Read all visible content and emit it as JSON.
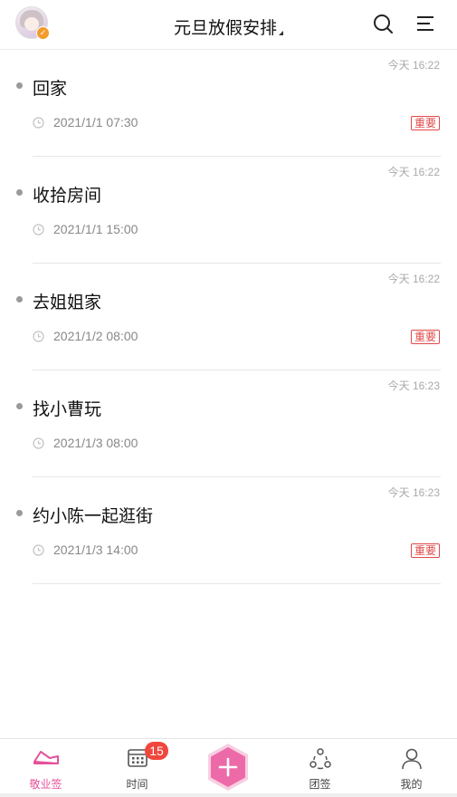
{
  "header": {
    "title": "元旦放假安排"
  },
  "items": [
    {
      "updated": "今天 16:22",
      "text": "回家",
      "time": "2021/1/1 07:30",
      "tag": "重要"
    },
    {
      "updated": "今天 16:22",
      "text": "收拾房间",
      "time": "2021/1/1 15:00",
      "tag": ""
    },
    {
      "updated": "今天 16:22",
      "text": "去姐姐家",
      "time": "2021/1/2 08:00",
      "tag": "重要"
    },
    {
      "updated": "今天 16:23",
      "text": "找小曹玩",
      "time": "2021/1/3 08:00",
      "tag": ""
    },
    {
      "updated": "今天 16:23",
      "text": "约小陈一起逛街",
      "time": "2021/1/3 14:00",
      "tag": "重要"
    }
  ],
  "tabs": {
    "notes": "敬业签",
    "time": "时间",
    "time_badge": "15",
    "team": "团签",
    "mine": "我的"
  },
  "colors": {
    "accent": "#e6519a",
    "important": "#e04848",
    "badge": "#f0463c"
  }
}
